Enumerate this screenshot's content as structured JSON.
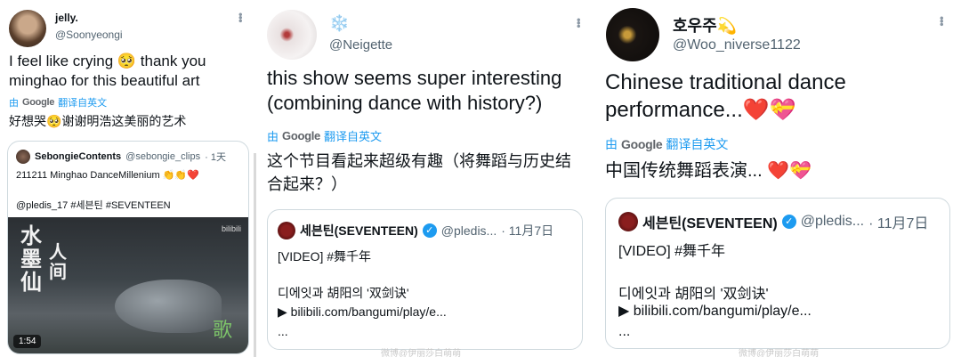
{
  "tweet1": {
    "display_name": "jelly.",
    "handle": "@Soonyeongi",
    "text": "I feel like crying 🥺 thank you minghao for this beautiful art",
    "translate_prefix": "由",
    "translate_brand": "Google",
    "translate_label": "翻译自英文",
    "translated": "好想哭🥺谢谢明浩这美丽的艺术",
    "quote": {
      "name": "SebongieContents",
      "handle": "@sebongie_clips",
      "time": "· 1天",
      "line1": "211211 Minghao DanceMillenium 👏👏❤️",
      "line2": "@pledis_17 #세븐틴 #SEVENTEEN",
      "video_title": "水墨仙",
      "video_title2": "人间",
      "video_logo": "bilibili",
      "duration": "1:54"
    }
  },
  "tweet2": {
    "display_name": "❄️",
    "handle": "@Neigette",
    "text": "this show seems super interesting (combining dance with history?)",
    "translate_prefix": "由",
    "translate_brand": "Google",
    "translate_label": "翻译自英文",
    "translated": "这个节目看起来超级有趣（将舞蹈与历史结合起来？）",
    "quote": {
      "name": "세븐틴(SEVENTEEN)",
      "handle": "@pledis...",
      "time": "· 11月7日",
      "line1": "[VIDEO] #舞千年",
      "line2": "디에잇과 胡阳의 '双剑诀'",
      "line3": "▶ bilibili.com/bangumi/play/e...",
      "line4": "..."
    },
    "watermark": "微博@伊丽莎白萌萌"
  },
  "tweet3": {
    "display_name": "호우주💫",
    "handle": "@Woo_niverse1122",
    "text": "Chinese traditional dance performance...❤️💝",
    "translate_prefix": "由",
    "translate_brand": "Google",
    "translate_label": "翻译自英文",
    "translated": "中国传统舞蹈表演... ❤️💝",
    "quote": {
      "name": "세븐틴(SEVENTEEN)",
      "handle": "@pledis...",
      "time": "· 11月7日",
      "line1": "[VIDEO] #舞千年",
      "line2": "디에잇과 胡阳의 '双剑诀'",
      "line3": "▶ bilibili.com/bangumi/play/e...",
      "line4": "..."
    },
    "watermark": "微博@伊丽莎白萌萌"
  },
  "colors": {
    "link": "#1d9bf0",
    "muted": "#536471",
    "border": "#cfd9de"
  },
  "icons": [
    "more-options-icon",
    "verified-badge-icon",
    "google-logo-icon",
    "seventeen-logo-icon"
  ]
}
